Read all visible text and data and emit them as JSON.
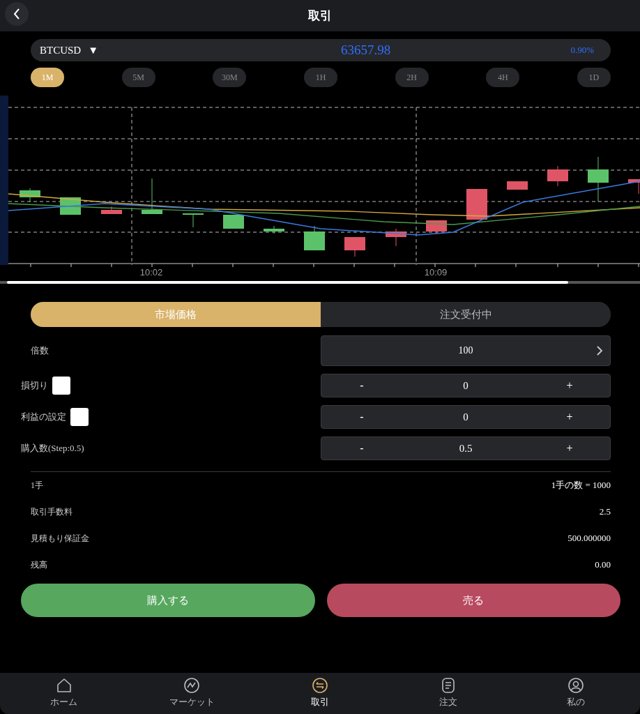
{
  "header": {
    "title": "取引"
  },
  "ticker": {
    "symbol": "BTCUSD",
    "caret": "▼",
    "price": "63657.98",
    "change": "0.90%"
  },
  "intervals": [
    {
      "label": "1M",
      "selected": true
    },
    {
      "label": "5M",
      "selected": false
    },
    {
      "label": "30M",
      "selected": false
    },
    {
      "label": "1H",
      "selected": false
    },
    {
      "label": "2H",
      "selected": false
    },
    {
      "label": "4H",
      "selected": false
    },
    {
      "label": "1D",
      "selected": false
    }
  ],
  "chart": {
    "time_labels": [
      "10:02",
      "10:09"
    ]
  },
  "order_tabs": [
    {
      "label": "市場価格",
      "selected": true
    },
    {
      "label": "注文受付中",
      "selected": false
    }
  ],
  "leverage": {
    "label": "倍数",
    "value": "100"
  },
  "steppers": [
    {
      "label": "損切り",
      "kind": "checkbox",
      "checked": false,
      "minus": "-",
      "value": "0",
      "plus": "+"
    },
    {
      "label": "利益の設定",
      "kind": "checkbox",
      "checked": false,
      "minus": "-",
      "value": "0",
      "plus": "+"
    },
    {
      "label": "購入数(Step:0.5)",
      "kind": "plain",
      "minus": "-",
      "value": "0.5",
      "plus": "+"
    }
  ],
  "info": [
    {
      "label": "1手",
      "value": "1手の数 = 1000"
    },
    {
      "label": "取引手数料",
      "value": "2.5"
    },
    {
      "label": "見積もり保証金",
      "value": "500.000000"
    },
    {
      "label": "残高",
      "value": "0.00"
    }
  ],
  "actions": [
    {
      "label": "購入する",
      "kind": "buy"
    },
    {
      "label": "売る",
      "kind": "sell"
    }
  ],
  "nav": [
    {
      "label": "ホーム",
      "kind": "home",
      "selected": false
    },
    {
      "label": "マーケット",
      "kind": "market",
      "selected": false
    },
    {
      "label": "取引",
      "kind": "trade",
      "selected": true
    },
    {
      "label": "注文",
      "kind": "orders",
      "selected": false
    },
    {
      "label": "私の",
      "kind": "me",
      "selected": false
    }
  ]
}
